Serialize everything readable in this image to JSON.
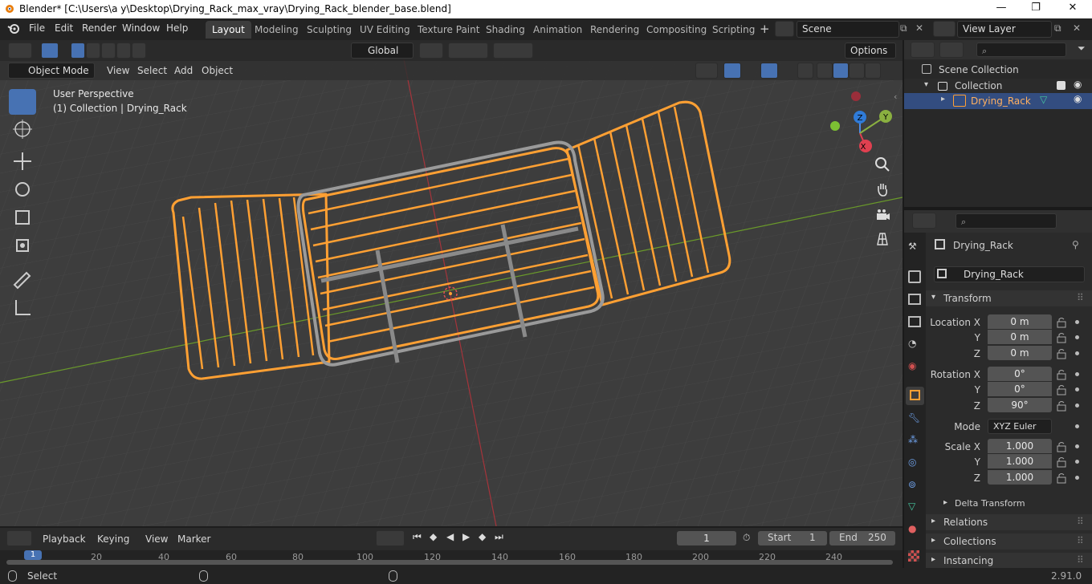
{
  "window": {
    "title": "Blender* [C:\\Users\\a y\\Desktop\\Drying_Rack_max_vray\\Drying_Rack_blender_base.blend]"
  },
  "menu": [
    "File",
    "Edit",
    "Render",
    "Window",
    "Help"
  ],
  "workspaces": [
    "Layout",
    "Modeling",
    "Sculpting",
    "UV Editing",
    "Texture Paint",
    "Shading",
    "Animation",
    "Rendering",
    "Compositing",
    "Scripting"
  ],
  "scene": {
    "name": "Scene",
    "view_layer": "View Layer"
  },
  "toolbar": {
    "orientation": "Global",
    "options": "Options"
  },
  "viewport_header": {
    "mode": "Object Mode",
    "view": "View",
    "select": "Select",
    "add": "Add",
    "object": "Object"
  },
  "viewport": {
    "perspective": "User Perspective",
    "collection_info": "(1) Collection | Drying_Rack",
    "gizmo": {
      "x": "X",
      "y": "Y",
      "z": "Z"
    }
  },
  "outliner": {
    "scene_collection": "Scene Collection",
    "collection": "Collection",
    "object": "Drying_Rack"
  },
  "properties": {
    "object_name": "Drying_Rack",
    "data_name": "Drying_Rack",
    "transform_title": "Transform",
    "location": {
      "label_x": "Location X",
      "label_y": "Y",
      "label_z": "Z",
      "x": "0 m",
      "y": "0 m",
      "z": "0 m"
    },
    "rotation": {
      "label_x": "Rotation X",
      "label_y": "Y",
      "label_z": "Z",
      "x": "0°",
      "y": "0°",
      "z": "90°"
    },
    "mode": {
      "label": "Mode",
      "value": "XYZ Euler"
    },
    "scale": {
      "label_x": "Scale X",
      "label_y": "Y",
      "label_z": "Z",
      "x": "1.000",
      "y": "1.000",
      "z": "1.000"
    },
    "delta": "Delta Transform",
    "relations": "Relations",
    "collections": "Collections",
    "instancing": "Instancing"
  },
  "timeline": {
    "playback": "Playback",
    "keying": "Keying",
    "view": "View",
    "marker": "Marker",
    "current_frame": "1",
    "start_label": "Start",
    "start": "1",
    "end_label": "End",
    "end": "250",
    "ruler": [
      "1",
      "20",
      "40",
      "60",
      "80",
      "100",
      "120",
      "140",
      "160",
      "180",
      "200",
      "220",
      "240"
    ]
  },
  "statusbar": {
    "select": "Select",
    "version": "2.91.0"
  },
  "colors": {
    "accent": "#4772b3",
    "selection": "#ffa033",
    "grid_x_axis": "#a5343b",
    "grid_y_axis": "#6a9a2a"
  }
}
